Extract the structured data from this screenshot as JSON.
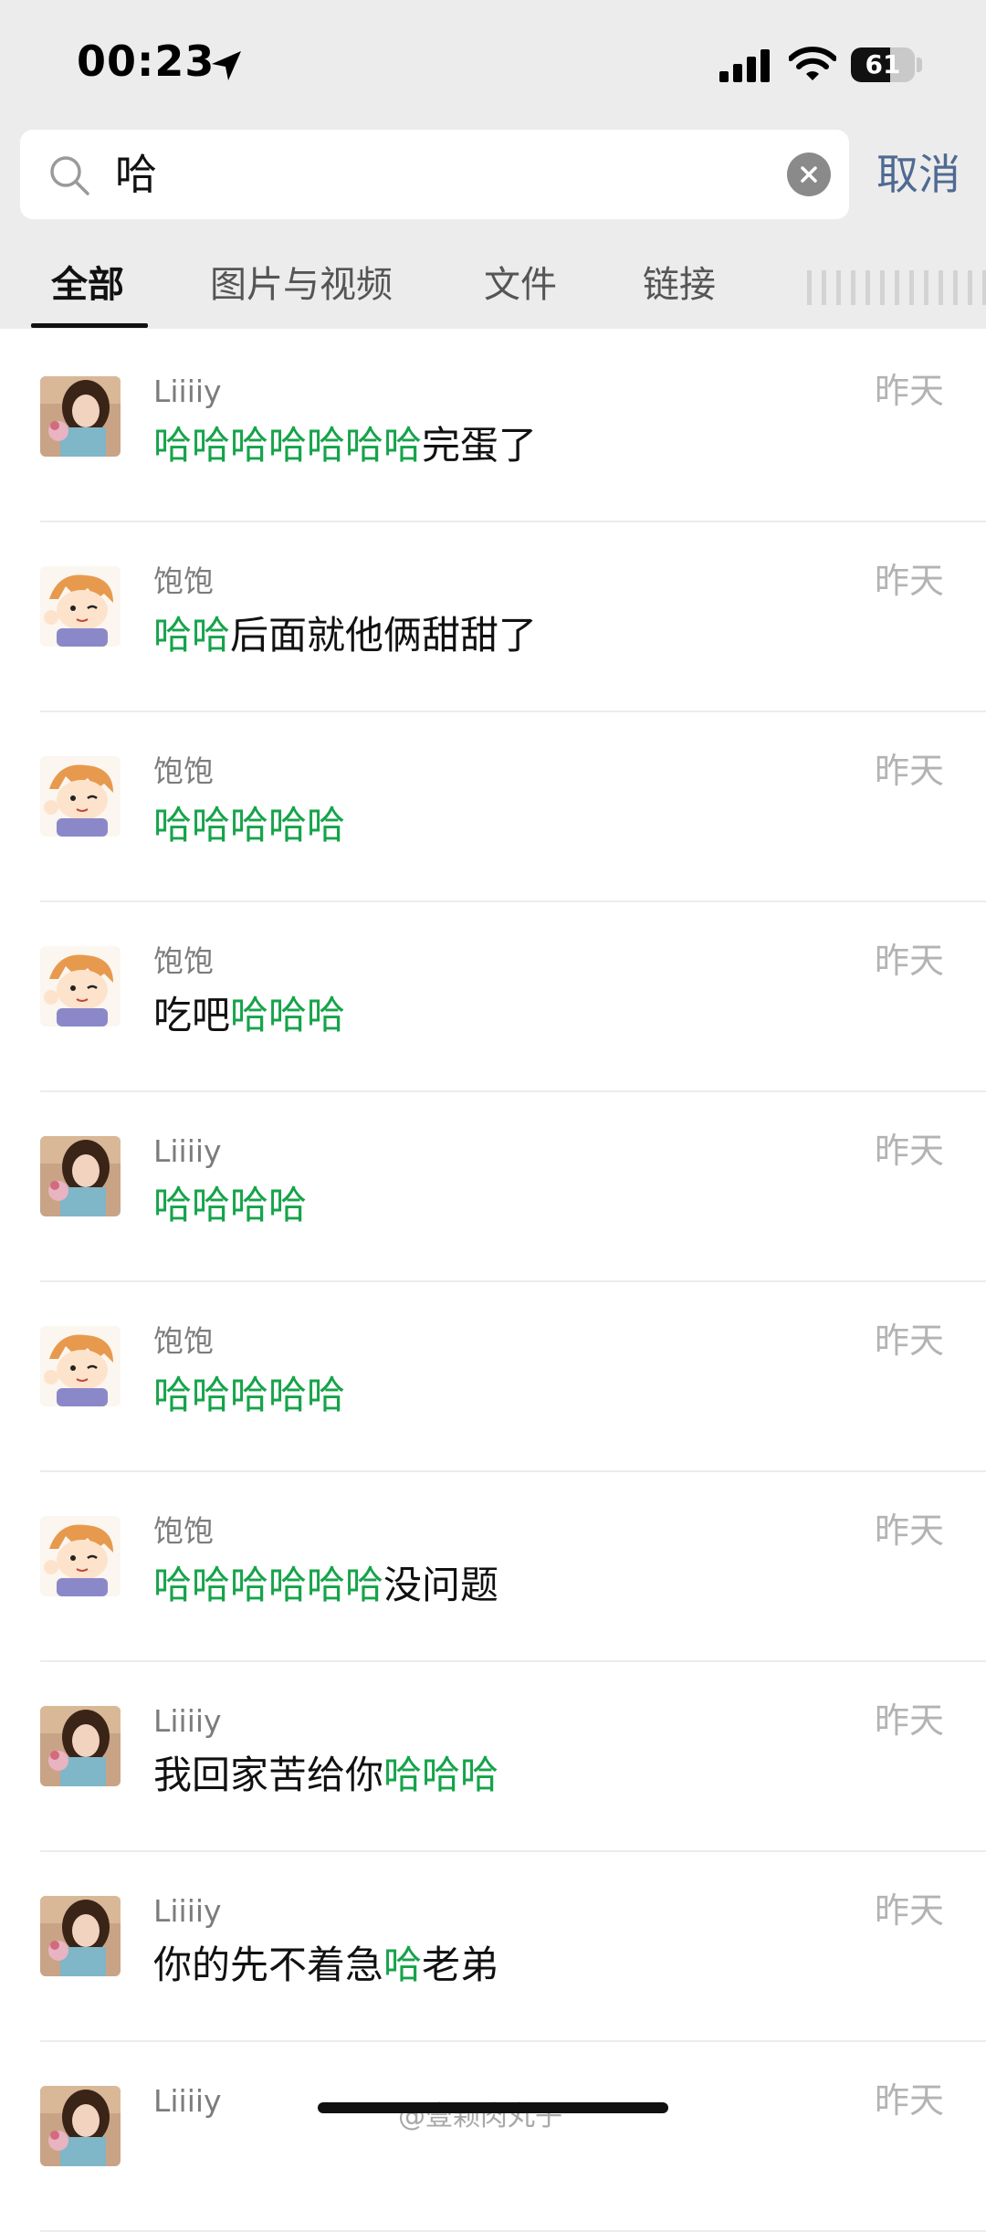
{
  "status_bar": {
    "time": "00:23",
    "battery": "61",
    "battery_level": 0.61
  },
  "search": {
    "query": "哈",
    "cancel_label": "取消"
  },
  "tabs": [
    {
      "label": "全部",
      "active": true
    },
    {
      "label": "图片与视频",
      "active": false
    },
    {
      "label": "文件",
      "active": false
    },
    {
      "label": "链接",
      "active": false
    }
  ],
  "results": [
    {
      "name": "Liiiiy",
      "time": "昨天",
      "avatar": "girl",
      "segments": [
        {
          "text": "哈哈哈哈哈哈哈",
          "hl": true
        },
        {
          "text": "完蛋了",
          "hl": false
        }
      ]
    },
    {
      "name": "饱饱",
      "time": "昨天",
      "avatar": "cartoon",
      "segments": [
        {
          "text": "哈哈",
          "hl": true
        },
        {
          "text": "后面就他俩甜甜了",
          "hl": false
        }
      ]
    },
    {
      "name": "饱饱",
      "time": "昨天",
      "avatar": "cartoon",
      "segments": [
        {
          "text": "哈哈哈哈哈",
          "hl": true
        }
      ]
    },
    {
      "name": "饱饱",
      "time": "昨天",
      "avatar": "cartoon",
      "segments": [
        {
          "text": "吃吧",
          "hl": false
        },
        {
          "text": "哈哈哈",
          "hl": true
        }
      ]
    },
    {
      "name": "Liiiiy",
      "time": "昨天",
      "avatar": "girl",
      "segments": [
        {
          "text": "哈哈哈哈",
          "hl": true
        }
      ]
    },
    {
      "name": "饱饱",
      "time": "昨天",
      "avatar": "cartoon",
      "segments": [
        {
          "text": "哈哈哈哈哈",
          "hl": true
        }
      ]
    },
    {
      "name": "饱饱",
      "time": "昨天",
      "avatar": "cartoon",
      "segments": [
        {
          "text": "哈哈哈哈哈哈",
          "hl": true
        },
        {
          "text": "没问题",
          "hl": false
        }
      ]
    },
    {
      "name": "Liiiiy",
      "time": "昨天",
      "avatar": "girl",
      "segments": [
        {
          "text": "我回家苦给你",
          "hl": false
        },
        {
          "text": "哈哈哈",
          "hl": true
        }
      ]
    },
    {
      "name": "Liiiiy",
      "time": "昨天",
      "avatar": "girl",
      "segments": [
        {
          "text": "你的先不着急",
          "hl": false
        },
        {
          "text": "哈",
          "hl": true
        },
        {
          "text": "老弟",
          "hl": false
        }
      ]
    },
    {
      "name": "Liiiiy",
      "time": "昨天",
      "avatar": "girl",
      "segments": []
    }
  ],
  "watermark": "@壹颗肉丸子",
  "colors": {
    "highlight": "#16a34a",
    "cancel": "#4f6a92",
    "header_bg": "#ececec"
  }
}
